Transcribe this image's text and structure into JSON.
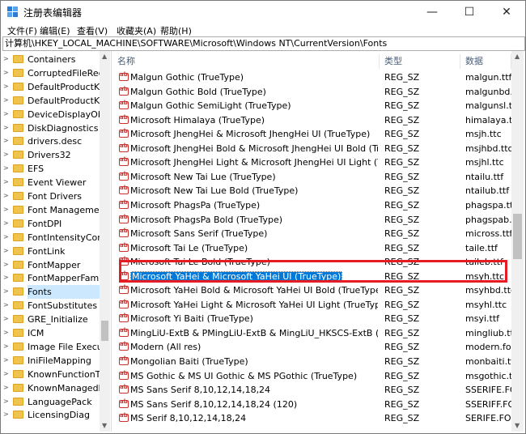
{
  "window": {
    "title": "注册表编辑器"
  },
  "menu": [
    "文件(F)",
    "编辑(E)",
    "查看(V)",
    "收藏夹(A)",
    "帮助(H)"
  ],
  "address": "计算机\\HKEY_LOCAL_MACHINE\\SOFTWARE\\Microsoft\\Windows NT\\CurrentVersion\\Fonts",
  "columns": {
    "name": "名称",
    "type": "类型",
    "data": "数据"
  },
  "tree": [
    {
      "label": "Containers"
    },
    {
      "label": "CorruptedFileRecc"
    },
    {
      "label": "DefaultProductKey"
    },
    {
      "label": "DefaultProductKey"
    },
    {
      "label": "DeviceDisplayObje"
    },
    {
      "label": "DiskDiagnostics"
    },
    {
      "label": "drivers.desc"
    },
    {
      "label": "Drivers32"
    },
    {
      "label": "EFS"
    },
    {
      "label": "Event Viewer"
    },
    {
      "label": "Font Drivers"
    },
    {
      "label": "Font Management"
    },
    {
      "label": "FontDPI"
    },
    {
      "label": "FontIntensityCorre"
    },
    {
      "label": "FontLink"
    },
    {
      "label": "FontMapper"
    },
    {
      "label": "FontMapperFamily"
    },
    {
      "label": "Fonts",
      "selected": true
    },
    {
      "label": "FontSubstitutes"
    },
    {
      "label": "GRE_Initialize"
    },
    {
      "label": "ICM"
    },
    {
      "label": "Image File Executi"
    },
    {
      "label": "IniFileMapping"
    },
    {
      "label": "KnownFunctionTab"
    },
    {
      "label": "KnownManagedDe"
    },
    {
      "label": "LanguagePack"
    },
    {
      "label": "LicensingDiag"
    }
  ],
  "rows": [
    {
      "name": "Malgun Gothic (TrueType)",
      "type": "REG_SZ",
      "data": "malgun.ttf"
    },
    {
      "name": "Malgun Gothic Bold (TrueType)",
      "type": "REG_SZ",
      "data": "malgunbd.ttf"
    },
    {
      "name": "Malgun Gothic SemiLight (TrueType)",
      "type": "REG_SZ",
      "data": "malgunsl.ttf"
    },
    {
      "name": "Microsoft Himalaya (TrueType)",
      "type": "REG_SZ",
      "data": "himalaya.ttf"
    },
    {
      "name": "Microsoft JhengHei & Microsoft JhengHei UI (TrueType)",
      "type": "REG_SZ",
      "data": "msjh.ttc"
    },
    {
      "name": "Microsoft JhengHei Bold & Microsoft JhengHei UI Bold (TrueType)",
      "type": "REG_SZ",
      "data": "msjhbd.ttc"
    },
    {
      "name": "Microsoft JhengHei Light & Microsoft JhengHei UI Light (TrueType)",
      "type": "REG_SZ",
      "data": "msjhl.ttc"
    },
    {
      "name": "Microsoft New Tai Lue (TrueType)",
      "type": "REG_SZ",
      "data": "ntailu.ttf"
    },
    {
      "name": "Microsoft New Tai Lue Bold (TrueType)",
      "type": "REG_SZ",
      "data": "ntailub.ttf"
    },
    {
      "name": "Microsoft PhagsPa (TrueType)",
      "type": "REG_SZ",
      "data": "phagspa.ttf"
    },
    {
      "name": "Microsoft PhagsPa Bold (TrueType)",
      "type": "REG_SZ",
      "data": "phagspab.ttf"
    },
    {
      "name": "Microsoft Sans Serif (TrueType)",
      "type": "REG_SZ",
      "data": "micross.ttf"
    },
    {
      "name": "Microsoft Tai Le (TrueType)",
      "type": "REG_SZ",
      "data": "taile.ttf"
    },
    {
      "name": "Microsoft Tai Le Bold (TrueType)",
      "type": "REG_SZ",
      "data": "taileb.ttf"
    },
    {
      "name": "Microsoft YaHei & Microsoft YaHei UI (TrueType)",
      "type": "REG_SZ",
      "data": "msyh.ttc",
      "selected": true
    },
    {
      "name": "Microsoft YaHei Bold & Microsoft YaHei UI Bold (TrueType)",
      "type": "REG_SZ",
      "data": "msyhbd.ttc"
    },
    {
      "name": "Microsoft YaHei Light & Microsoft YaHei UI Light (TrueType)",
      "type": "REG_SZ",
      "data": "msyhl.ttc"
    },
    {
      "name": "Microsoft Yi Baiti (TrueType)",
      "type": "REG_SZ",
      "data": "msyi.ttf"
    },
    {
      "name": "MingLiU-ExtB & PMingLiU-ExtB & MingLiU_HKSCS-ExtB (TrueType)",
      "type": "REG_SZ",
      "data": "mingliub.ttc"
    },
    {
      "name": "Modern (All res)",
      "type": "REG_SZ",
      "data": "modern.fon"
    },
    {
      "name": "Mongolian Baiti (TrueType)",
      "type": "REG_SZ",
      "data": "monbaiti.ttf"
    },
    {
      "name": "MS Gothic & MS UI Gothic & MS PGothic (TrueType)",
      "type": "REG_SZ",
      "data": "msgothic.ttc"
    },
    {
      "name": "MS Sans Serif 8,10,12,14,18,24",
      "type": "REG_SZ",
      "data": "SSERIFE.FON"
    },
    {
      "name": "MS Sans Serif 8,10,12,14,18,24 (120)",
      "type": "REG_SZ",
      "data": "SSERIFF.FON"
    },
    {
      "name": "MS Serif 8,10,12,14,18,24",
      "type": "REG_SZ",
      "data": "SERIFE.FON"
    }
  ]
}
